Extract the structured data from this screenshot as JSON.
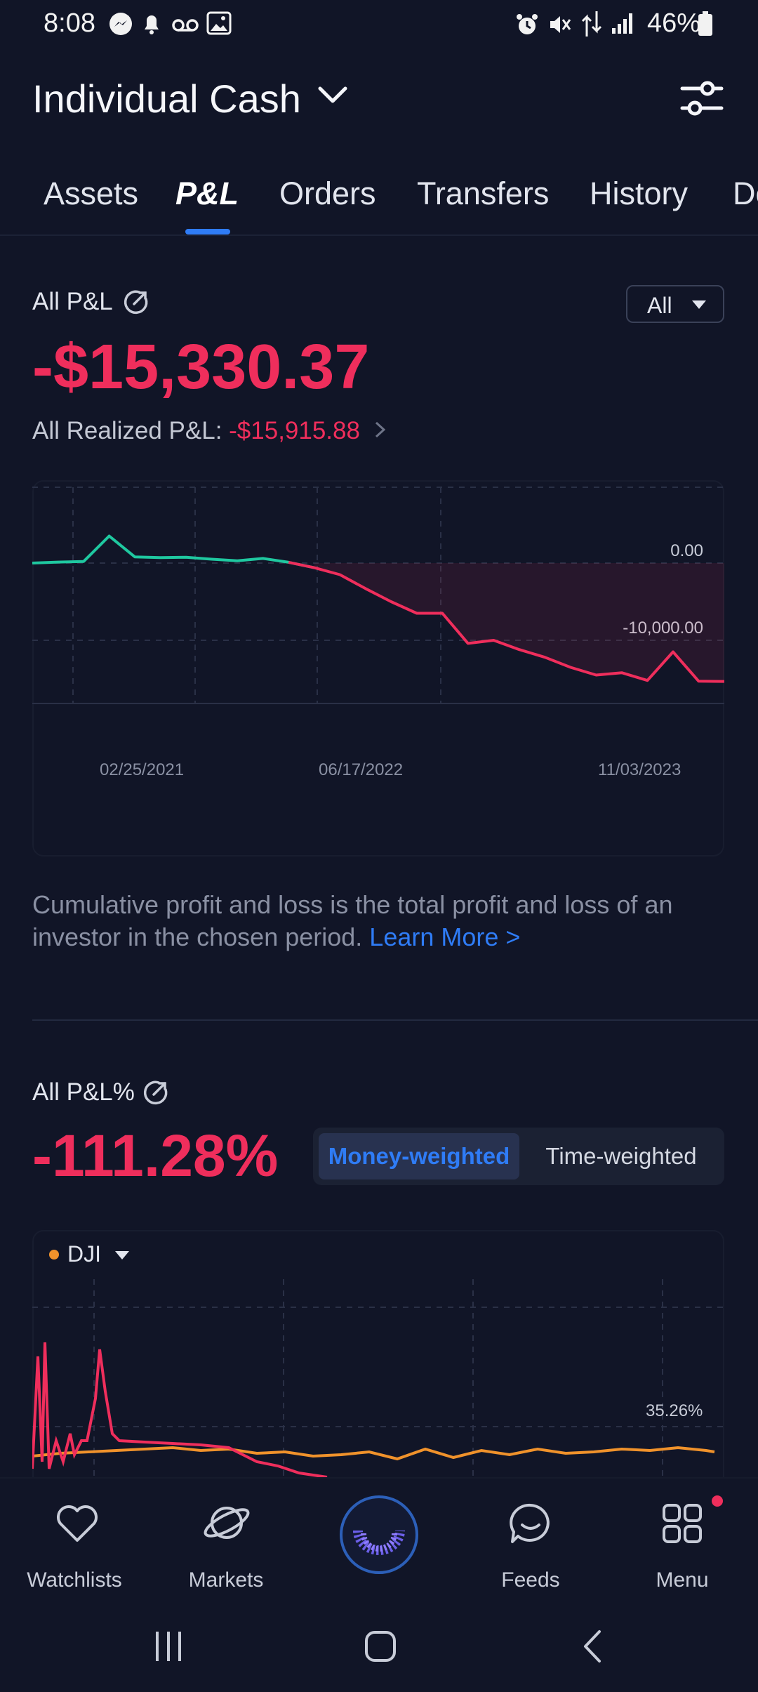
{
  "status_bar": {
    "time": "8:08",
    "battery": "46%"
  },
  "header": {
    "account_title": "Individual Cash"
  },
  "tabs": [
    {
      "label": "Assets"
    },
    {
      "label": "P&L"
    },
    {
      "label": "Orders"
    },
    {
      "label": "Transfers"
    },
    {
      "label": "History"
    },
    {
      "label": "De"
    }
  ],
  "pnl": {
    "title": "All P&L",
    "period": "All",
    "value": "-$15,330.37",
    "realized_label": "All Realized P&L: ",
    "realized_value": "-$15,915.88",
    "chart_data": {
      "type": "line",
      "x_ticks": [
        "02/25/2021",
        "06/17/2022",
        "11/03/2023"
      ],
      "y_ticks": [
        "0.00",
        "-10,000.00"
      ],
      "series": [
        {
          "values": [
            0,
            120,
            200,
            3500,
            800,
            700,
            750,
            500,
            300,
            600,
            100,
            -600,
            -1500,
            -3300,
            -5000,
            -6500,
            -6500,
            -10400,
            -10000,
            -11200,
            -12200,
            -13500,
            -14500,
            -14200,
            -15200,
            -11500,
            -15300,
            -15330
          ]
        }
      ],
      "colors": {
        "positive": "#1fc8a0",
        "negative": "#ef2e5c"
      }
    },
    "description": "Cumulative profit and loss is the total profit and loss of an investor in the chosen period. ",
    "learn_more": "Learn More >"
  },
  "pnl_pct": {
    "title": "All P&L%",
    "value": "-111.28%",
    "mode_options": [
      "Money-weighted",
      "Time-weighted"
    ],
    "benchmark": "DJI",
    "benchmark_color": "#f0922b",
    "y_label": "35.26%"
  },
  "bottom_nav": [
    {
      "label": "Watchlists",
      "icon": "heart-icon"
    },
    {
      "label": "Markets",
      "icon": "planet-icon"
    },
    {
      "label": "",
      "icon": "moomoo-logo-icon"
    },
    {
      "label": "Feeds",
      "icon": "chat-icon"
    },
    {
      "label": "Menu",
      "icon": "grid-icon"
    }
  ]
}
